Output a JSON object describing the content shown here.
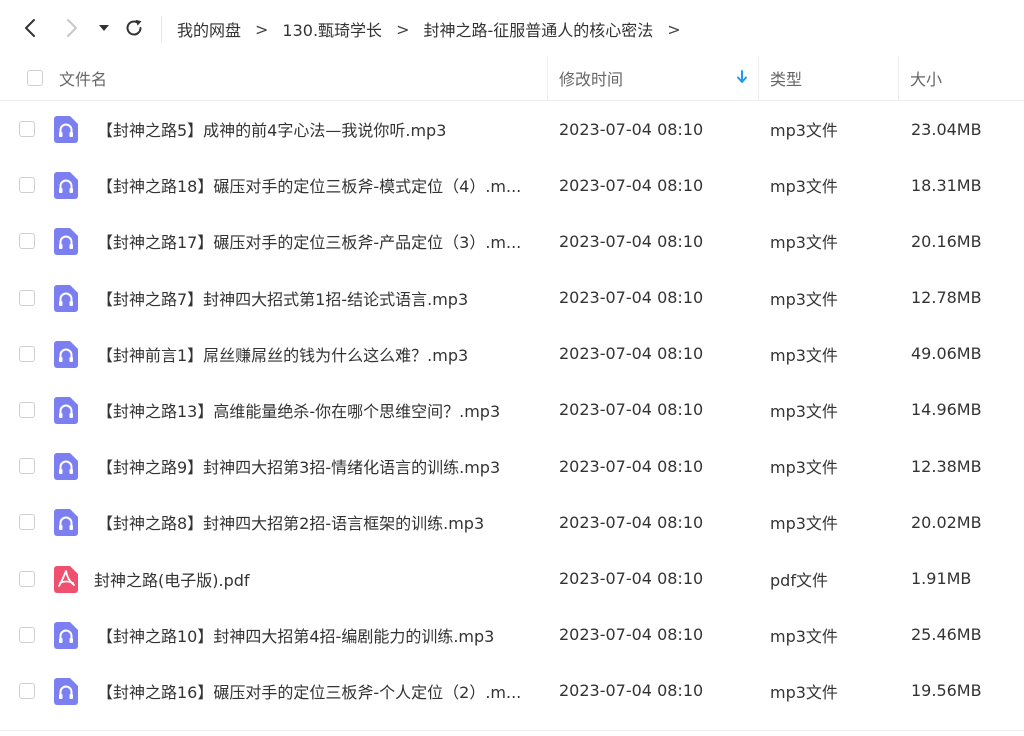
{
  "breadcrumb": [
    "我的网盘",
    "130.甄琦学长",
    "封神之路-征服普通人的核心密法"
  ],
  "breadcrumb_separator": ">",
  "header": {
    "name": "文件名",
    "modified": "修改时间",
    "type": "类型",
    "size": "大小"
  },
  "colors": {
    "audio_icon": "#7b7ff0",
    "pdf_icon": "#f0506e",
    "sort_arrow": "#1e9bf0"
  },
  "files": [
    {
      "name": "【封神之路5】成神的前4字心法—我说你听.mp3",
      "time": "2023-07-04 08:10",
      "type": "mp3文件",
      "size": "23.04MB",
      "icon": "audio-icon"
    },
    {
      "name": "【封神之路18】碾压对手的定位三板斧-模式定位（4）.m...",
      "time": "2023-07-04 08:10",
      "type": "mp3文件",
      "size": "18.31MB",
      "icon": "audio-icon"
    },
    {
      "name": "【封神之路17】碾压对手的定位三板斧-产品定位（3）.m...",
      "time": "2023-07-04 08:10",
      "type": "mp3文件",
      "size": "20.16MB",
      "icon": "audio-icon"
    },
    {
      "name": "【封神之路7】封神四大招式第1招-结论式语言.mp3",
      "time": "2023-07-04 08:10",
      "type": "mp3文件",
      "size": "12.78MB",
      "icon": "audio-icon"
    },
    {
      "name": "【封神前言1】屌丝赚屌丝的钱为什么这么难？.mp3",
      "time": "2023-07-04 08:10",
      "type": "mp3文件",
      "size": "49.06MB",
      "icon": "audio-icon"
    },
    {
      "name": "【封神之路13】高维能量绝杀-你在哪个思维空间？.mp3",
      "time": "2023-07-04 08:10",
      "type": "mp3文件",
      "size": "14.96MB",
      "icon": "audio-icon"
    },
    {
      "name": "【封神之路9】封神四大招第3招-情绪化语言的训练.mp3",
      "time": "2023-07-04 08:10",
      "type": "mp3文件",
      "size": "12.38MB",
      "icon": "audio-icon"
    },
    {
      "name": "【封神之路8】封神四大招第2招-语言框架的训练.mp3",
      "time": "2023-07-04 08:10",
      "type": "mp3文件",
      "size": "20.02MB",
      "icon": "audio-icon"
    },
    {
      "name": "封神之路(电子版).pdf",
      "time": "2023-07-04 08:10",
      "type": "pdf文件",
      "size": "1.91MB",
      "icon": "pdf-icon"
    },
    {
      "name": "【封神之路10】封神四大招第4招-编剧能力的训练.mp3",
      "time": "2023-07-04 08:10",
      "type": "mp3文件",
      "size": "25.46MB",
      "icon": "audio-icon"
    },
    {
      "name": "【封神之路16】碾压对手的定位三板斧-个人定位（2）.m...",
      "time": "2023-07-04 08:10",
      "type": "mp3文件",
      "size": "19.56MB",
      "icon": "audio-icon"
    }
  ]
}
